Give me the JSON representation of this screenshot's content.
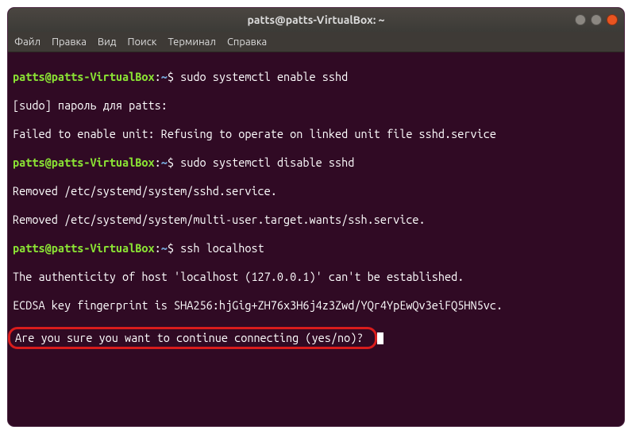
{
  "window": {
    "title": "patts@patts-VirtualBox: ~"
  },
  "menubar": {
    "items": [
      "Файл",
      "Правка",
      "Вид",
      "Поиск",
      "Терминал",
      "Справка"
    ]
  },
  "prompt": {
    "userhost": "patts@patts-VirtualBox",
    "colon": ":",
    "path": "~",
    "dollar": "$ "
  },
  "lines": {
    "cmd1": "sudo systemctl enable sshd",
    "out1": "[sudo] пароль для patts: ",
    "out2": "Failed to enable unit: Refusing to operate on linked unit file sshd.service",
    "cmd2": "sudo systemctl disable sshd",
    "out3": "Removed /etc/systemd/system/sshd.service.",
    "out4": "Removed /etc/systemd/system/multi-user.target.wants/ssh.service.",
    "cmd3": "ssh localhost",
    "out5": "The authenticity of host 'localhost (127.0.0.1)' can't be established.",
    "out6": "ECDSA key fingerprint is SHA256:hjGig+ZH76x3H6j4z3Zwd/YQr4YpEwQv3eiFQ5HN5vc.",
    "out7": "Are you sure you want to continue connecting (yes/no)? "
  }
}
